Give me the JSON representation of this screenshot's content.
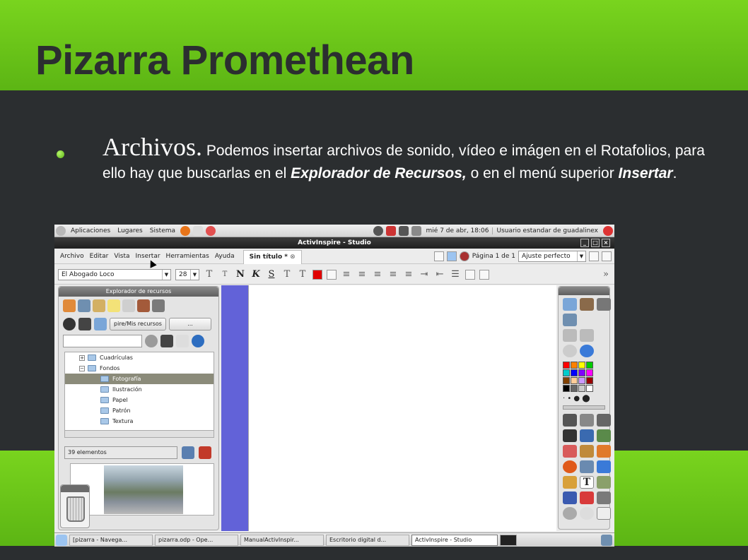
{
  "slide": {
    "title": "Pizarra Promethean",
    "bullet_lead": "Archivos.",
    "bullet_text_1": " Podemos insertar archivos de sonido, vídeo e imágen en el Rotafolios, para ello hay que buscarlas en el ",
    "bullet_bold_1": "Explorador de Recursos,",
    "bullet_text_2": " o en el menú superior ",
    "bullet_bold_2": "Insertar",
    "bullet_text_3": "."
  },
  "colors": {
    "green": "#79d41e",
    "dark": "#2b2e30",
    "canvas_strip": "#6262d8"
  },
  "gnome_panel": {
    "menus": [
      "Aplicaciones",
      "Lugares",
      "Sistema"
    ],
    "clock": "mié 7 de abr, 18:06",
    "user": "Usuario estandar de guadalinex"
  },
  "window": {
    "title": "ActivInspire - Studio",
    "buttons": [
      "_",
      "□",
      "×"
    ]
  },
  "menubar": {
    "items": [
      "Archivo",
      "Editar",
      "Vista",
      "Insertar",
      "Herramientas",
      "Ayuda"
    ],
    "tab": "Sin título *",
    "page": "Página 1 de 1",
    "zoom": "Ajuste perfecto"
  },
  "format": {
    "font": "El Abogado Loco",
    "size": "28",
    "bold": "N",
    "italic": "K",
    "underline": "S",
    "more": "»"
  },
  "explorer": {
    "title": "Explorador de recursos",
    "path": "pire/Mis recursos",
    "browse": "...",
    "tree": [
      {
        "label": "Cuadrículas",
        "level": 1,
        "expander": "+"
      },
      {
        "label": "Fondos",
        "level": 1,
        "expander": "−"
      },
      {
        "label": "Fotografía",
        "level": 2,
        "selected": true
      },
      {
        "label": "Ilustración",
        "level": 2
      },
      {
        "label": "Papel",
        "level": 2
      },
      {
        "label": "Patrón",
        "level": 2
      },
      {
        "label": "Textura",
        "level": 2
      }
    ],
    "count": "39 elementos"
  },
  "toolbox": {
    "palette": [
      "#ff0000",
      "#ff8000",
      "#ffff00",
      "#00cc00",
      "#00cccc",
      "#0000ff",
      "#8000ff",
      "#ff00ff",
      "#804000",
      "#ffcc99",
      "#cc99ff",
      "#990000",
      "#000000",
      "#666666",
      "#cccccc",
      "#ffffff"
    ],
    "text_tool": "T"
  },
  "taskbar": {
    "tasks": [
      "[pizarra - Navega...",
      "pizarra.odp - Ope...",
      "ManualActivInspir...",
      "Escritorio digital d...",
      "ActivInspire - Studio"
    ]
  }
}
